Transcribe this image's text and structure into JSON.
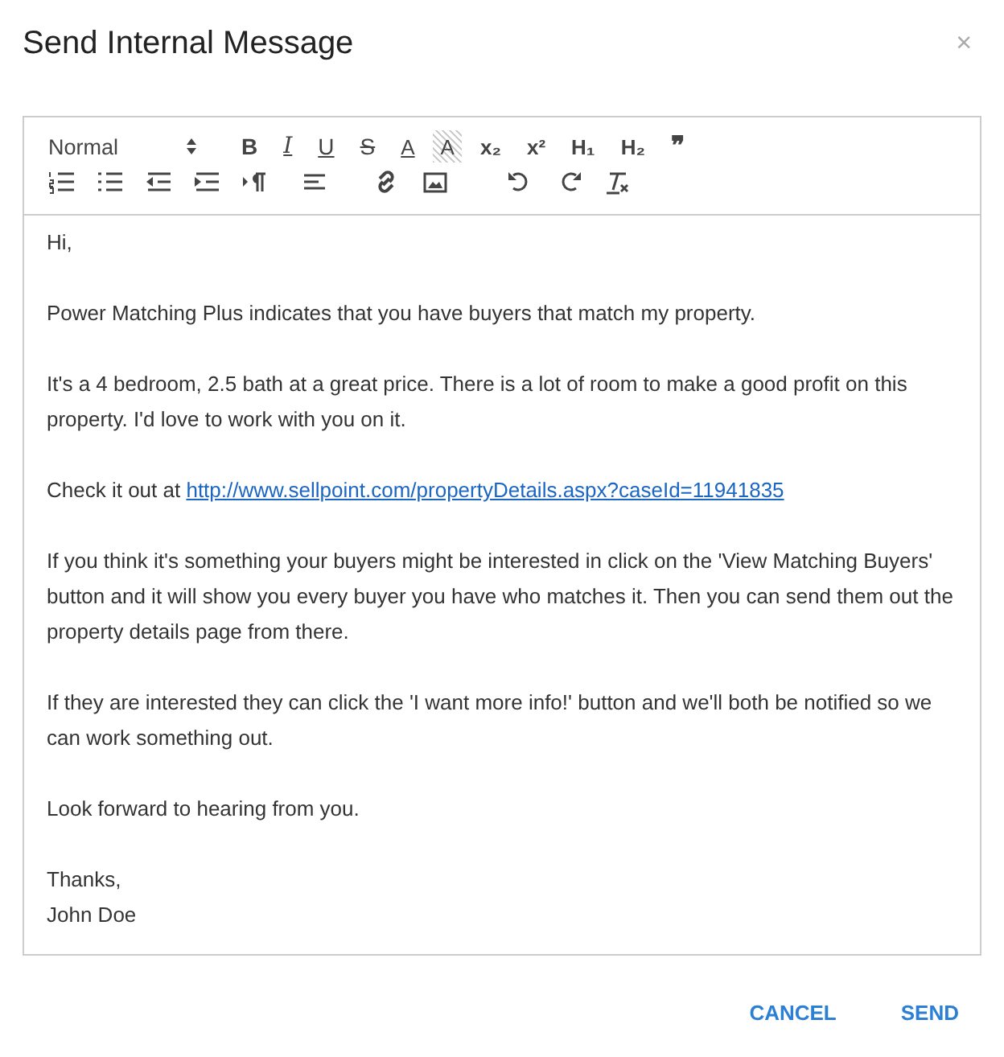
{
  "dialog": {
    "title": "Send Internal Message",
    "close": "×"
  },
  "toolbar": {
    "rows": [
      [
        {
          "kind": "select",
          "label": "Normal"
        },
        {
          "kind": "text",
          "label": "B"
        },
        {
          "kind": "text",
          "label": "I"
        },
        {
          "kind": "text",
          "label": "U"
        },
        {
          "kind": "text",
          "label": "S"
        },
        {
          "kind": "text",
          "label": "A"
        },
        {
          "kind": "text",
          "label": "A"
        },
        {
          "kind": "text",
          "label": "x₂"
        },
        {
          "kind": "text",
          "label": "x²"
        },
        {
          "kind": "text",
          "label": "H₁"
        },
        {
          "kind": "text",
          "label": "H₂"
        },
        {
          "kind": "text",
          "label": "❞"
        }
      ],
      [
        {
          "kind": "icon"
        },
        {
          "kind": "icon"
        },
        {
          "kind": "icon"
        },
        {
          "kind": "icon"
        },
        {
          "kind": "icon"
        },
        {
          "kind": "icon"
        },
        {
          "kind": "icon"
        },
        {
          "kind": "icon"
        },
        {
          "kind": "icon"
        },
        {
          "kind": "icon"
        },
        {
          "kind": "icon"
        }
      ]
    ]
  },
  "message": [
    {
      "kind": "text",
      "text": "Hi,"
    },
    {
      "kind": "text",
      "text": "Power Matching Plus indicates that you have buyers that match my property."
    },
    {
      "kind": "text",
      "text": "It's a 4 bedroom, 2.5 bath at a great price. There is a lot of room to make a good profit on this property. I'd love to work with you on it."
    },
    {
      "kind": "link",
      "text": "Check it out at ",
      "link": "http://www.sellpoint.com/propertyDetails.aspx?caseId=11941835"
    },
    {
      "kind": "text",
      "text": "If you think it's something your buyers might be interested in click on the 'View Matching Buyers' button and it will show you every buyer you have who matches it. Then you can send them out the property details page from there."
    },
    {
      "kind": "text",
      "text": "If they are interested they can click the 'I want more info!' button and we'll both be notified so we can work something out."
    },
    {
      "kind": "text",
      "text": "Look forward to hearing from you."
    },
    {
      "kind": "text",
      "text": "Thanks,\nJohn Doe"
    }
  ],
  "buttons": [
    {
      "label": "CANCEL"
    },
    {
      "label": "SEND"
    }
  ]
}
